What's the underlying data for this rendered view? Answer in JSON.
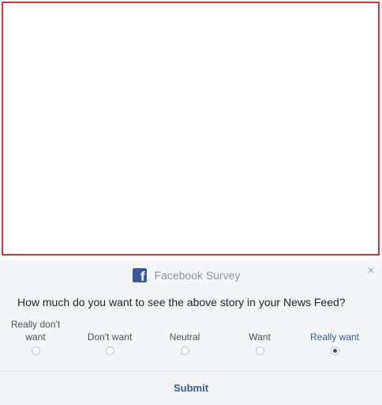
{
  "story": {},
  "survey": {
    "title": "Facebook Survey",
    "logo_letter": "f",
    "close_glyph": "×",
    "question": "How much do you want to see the above story in your News Feed?",
    "options": [
      {
        "label": "Really don't want",
        "selected": false
      },
      {
        "label": "Don't want",
        "selected": false
      },
      {
        "label": "Neutral",
        "selected": false
      },
      {
        "label": "Want",
        "selected": false
      },
      {
        "label": "Really want",
        "selected": true
      }
    ],
    "submit_label": "Submit"
  },
  "colors": {
    "frame_border": "#d9343a",
    "panel_bg": "#f4f5f7",
    "brand": "#3b5998",
    "link": "#365899"
  },
  "icons": {
    "logo": "facebook-logo-icon",
    "close": "close-icon"
  }
}
